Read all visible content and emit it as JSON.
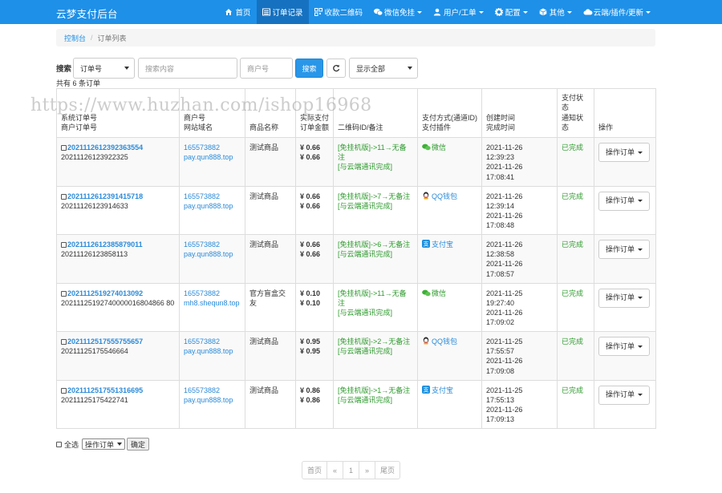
{
  "brand": "云梦支付后台",
  "nav": [
    {
      "label": "首页",
      "icon": "home-icon",
      "active": false,
      "caret": false
    },
    {
      "label": "订单记录",
      "icon": "list-icon",
      "active": true,
      "caret": false
    },
    {
      "label": "收款二维码",
      "icon": "qrcode-icon",
      "active": false,
      "caret": false
    },
    {
      "label": "微信免挂",
      "icon": "wechat-icon",
      "active": false,
      "caret": true
    },
    {
      "label": "用户/工单",
      "icon": "user-icon",
      "active": false,
      "caret": true
    },
    {
      "label": "配置",
      "icon": "gear-icon",
      "active": false,
      "caret": true
    },
    {
      "label": "其他",
      "icon": "cube-icon",
      "active": false,
      "caret": true
    },
    {
      "label": "云端/插件/更新",
      "icon": "cloud-icon",
      "active": false,
      "caret": true
    }
  ],
  "breadcrumb": {
    "home": "控制台",
    "sep": "/",
    "current": "订单列表"
  },
  "search": {
    "label": "搜索",
    "field_select": "订单号",
    "keyword_placeholder": "搜索内容",
    "merchant_placeholder": "商户号",
    "search_button": "搜索",
    "status_select": "显示全部"
  },
  "total_text": "共有 6 条订单",
  "watermark": "https://www.huzhan.com/ishop16968",
  "table": {
    "headers": [
      [
        "系统订单号",
        "商户订单号"
      ],
      [
        "商户号",
        "网站域名"
      ],
      [
        "商品名称"
      ],
      [
        "实际支付",
        "订单金额"
      ],
      [
        "二维码ID/备注"
      ],
      [
        "支付方式(通道ID)",
        "支付插件"
      ],
      [
        "创建时间",
        "完成时间"
      ],
      [
        "支付状态",
        "通知状态"
      ],
      [
        "操作"
      ]
    ],
    "rows": [
      {
        "trade_no": "2021112612392363554",
        "out_trade_no": "20211126123922325",
        "pid": "165573882",
        "site": "pay.qun888.top",
        "name": "测试商品",
        "money": "¥ 0.66",
        "real": "¥ 0.66",
        "remark1": "[免挂机版]->11→无备注",
        "remark2": "[与云端通讯完成]",
        "pay_icon": "wechat-pay-icon",
        "pay_label": "微信",
        "ct_date": "2021-11-26",
        "ct_time": "12:39:23",
        "et_date": "2021-11-26",
        "et_time": "17:08:41",
        "status": "已完成",
        "op": "操作订单"
      },
      {
        "trade_no": "2021112612391415718",
        "out_trade_no": "20211126123914633",
        "pid": "165573882",
        "site": "pay.qun888.top",
        "name": "测试商品",
        "money": "¥ 0.66",
        "real": "¥ 0.66",
        "remark1": "[免挂机版]->7→无备注",
        "remark2": "[与云端通讯完成]",
        "pay_icon": "qq-pay-icon",
        "pay_label": "QQ钱包",
        "ct_date": "2021-11-26",
        "ct_time": "12:39:14",
        "et_date": "2021-11-26",
        "et_time": "17:08:48",
        "status": "已完成",
        "op": "操作订单"
      },
      {
        "trade_no": "2021112612385879011",
        "out_trade_no": "20211126123858113",
        "pid": "165573882",
        "site": "pay.qun888.top",
        "name": "测试商品",
        "money": "¥ 0.66",
        "real": "¥ 0.66",
        "remark1": "[免挂机版]->6→无备注",
        "remark2": "[与云端通讯完成]",
        "pay_icon": "alipay-icon",
        "pay_label": "支付宝",
        "ct_date": "2021-11-26",
        "ct_time": "12:38:58",
        "et_date": "2021-11-26",
        "et_time": "17:08:57",
        "status": "已完成",
        "op": "操作订单"
      },
      {
        "trade_no": "2021112519274013092",
        "out_trade_no": "20211125192740000016804866 80",
        "pid": "165573882",
        "site": "mh8.shequn8.top",
        "name": "官方盲盒交友",
        "money": "¥ 0.10",
        "real": "¥ 0.10",
        "remark1": "[免挂机版]->11→无备注",
        "remark2": "[与云端通讯完成]",
        "pay_icon": "wechat-pay-icon",
        "pay_label": "微信",
        "ct_date": "2021-11-25",
        "ct_time": "19:27:40",
        "et_date": "2021-11-26",
        "et_time": "17:09:02",
        "status": "已完成",
        "op": "操作订单"
      },
      {
        "trade_no": "2021112517555755657",
        "out_trade_no": "20211125175546664",
        "pid": "165573882",
        "site": "pay.qun888.top",
        "name": "测试商品",
        "money": "¥ 0.95",
        "real": "¥ 0.95",
        "remark1": "[免挂机版]->2→无备注",
        "remark2": "[与云端通讯完成]",
        "pay_icon": "qq-pay-icon",
        "pay_label": "QQ钱包",
        "ct_date": "2021-11-25",
        "ct_time": "17:55:57",
        "et_date": "2021-11-26",
        "et_time": "17:09:08",
        "status": "已完成",
        "op": "操作订单"
      },
      {
        "trade_no": "2021112517551316695",
        "out_trade_no": "20211125175422741",
        "pid": "165573882",
        "site": "pay.qun888.top",
        "name": "测试商品",
        "money": "¥ 0.86",
        "real": "¥ 0.86",
        "remark1": "[免挂机版]->1→无备注",
        "remark2": "[与云端通讯完成]",
        "pay_icon": "alipay-icon",
        "pay_label": "支付宝",
        "ct_date": "2021-11-25",
        "ct_time": "17:55:13",
        "et_date": "2021-11-26",
        "et_time": "17:09:13",
        "status": "已完成",
        "op": "操作订单"
      }
    ]
  },
  "bulk": {
    "select_all": "全选",
    "action_select": "操作订单",
    "confirm": "确定"
  },
  "pager": [
    "首页",
    "«",
    "1",
    "»",
    "尾页"
  ],
  "colors": {
    "navbar": "#1e90e8",
    "nav_active": "#1672c0",
    "link": "#2a8ad8",
    "success": "#2e9a2e",
    "primary_button": "#2a96e8"
  }
}
